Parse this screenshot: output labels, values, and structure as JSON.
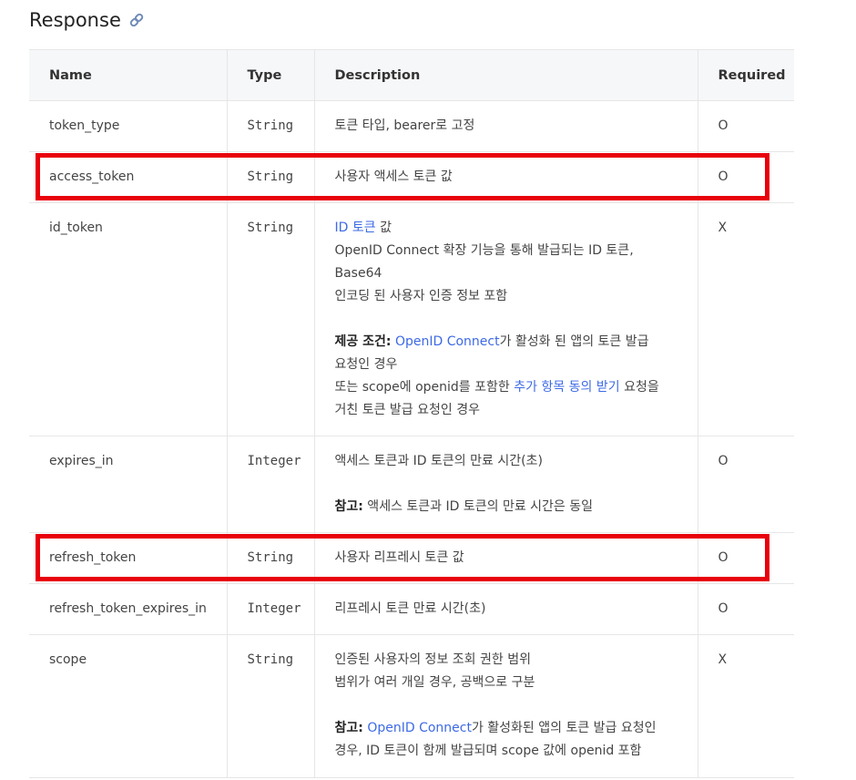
{
  "section": {
    "title": "Response",
    "link_icon": "link-icon"
  },
  "columns": {
    "name": "Name",
    "type": "Type",
    "description": "Description",
    "required": "Required"
  },
  "rows": [
    {
      "name": "token_type",
      "type": "String",
      "required": "O",
      "lines": [
        [
          {
            "text": "토큰 타입, bearer로 고정"
          }
        ]
      ]
    },
    {
      "name": "access_token",
      "type": "String",
      "required": "O",
      "lines": [
        [
          {
            "text": "사용자 액세스 토큰 값"
          }
        ]
      ]
    },
    {
      "name": "id_token",
      "type": "String",
      "required": "X",
      "lines": [
        [
          {
            "text": "ID 토큰",
            "style": "link"
          },
          {
            "text": " 값"
          }
        ],
        [
          {
            "text": "OpenID Connect 확장 기능을 통해 발급되는 ID 토큰, Base64"
          }
        ],
        [
          {
            "text": "인코딩 된 사용자 인증 정보 포함"
          }
        ],
        [
          {
            "text": "제공 조건:",
            "style": "bold"
          },
          {
            "text": " "
          },
          {
            "text": "OpenID Connect",
            "style": "link"
          },
          {
            "text": "가 활성화 된 앱의 토큰 발급"
          }
        ],
        [
          {
            "text": "요청인 경우"
          }
        ],
        [
          {
            "text": "또는 scope에 openid를 포함한 "
          },
          {
            "text": "추가 항목 동의 받기",
            "style": "link"
          },
          {
            "text": " 요청을"
          }
        ],
        [
          {
            "text": "거친 토큰 발급 요청인 경우"
          }
        ]
      ],
      "gaps": [
        3
      ]
    },
    {
      "name": "expires_in",
      "type": "Integer",
      "required": "O",
      "lines": [
        [
          {
            "text": "액세스 토큰과 ID 토큰의 만료 시간(초)"
          }
        ],
        [
          {
            "text": "참고:",
            "style": "bold"
          },
          {
            "text": " 액세스 토큰과 ID 토큰의 만료 시간은 동일"
          }
        ]
      ],
      "gaps": [
        1
      ]
    },
    {
      "name": "refresh_token",
      "type": "String",
      "required": "O",
      "lines": [
        [
          {
            "text": "사용자 리프레시 토큰 값"
          }
        ]
      ]
    },
    {
      "name": "refresh_token_expires_in",
      "type": "Integer",
      "required": "O",
      "lines": [
        [
          {
            "text": "리프레시 토큰 만료 시간(초)"
          }
        ]
      ]
    },
    {
      "name": "scope",
      "type": "String",
      "required": "X",
      "lines": [
        [
          {
            "text": "인증된 사용자의 정보 조회 권한 범위"
          }
        ],
        [
          {
            "text": "범위가 여러 개일 경우, 공백으로 구분"
          }
        ],
        [
          {
            "text": "참고:",
            "style": "bold"
          },
          {
            "text": " "
          },
          {
            "text": "OpenID Connect",
            "style": "link"
          },
          {
            "text": "가 활성화된 앱의 토큰 발급 요청인"
          }
        ],
        [
          {
            "text": "경우, ID 토큰이 함께 발급되며 scope 값에 openid 포함"
          }
        ]
      ],
      "gaps": [
        2
      ]
    }
  ],
  "highlighted_rows": [
    "access_token",
    "refresh_token"
  ],
  "colors": {
    "link": "#3d6ae5",
    "highlight": "#e8000b",
    "header_bg": "#f6f7f9",
    "border": "#e6e6e6"
  }
}
